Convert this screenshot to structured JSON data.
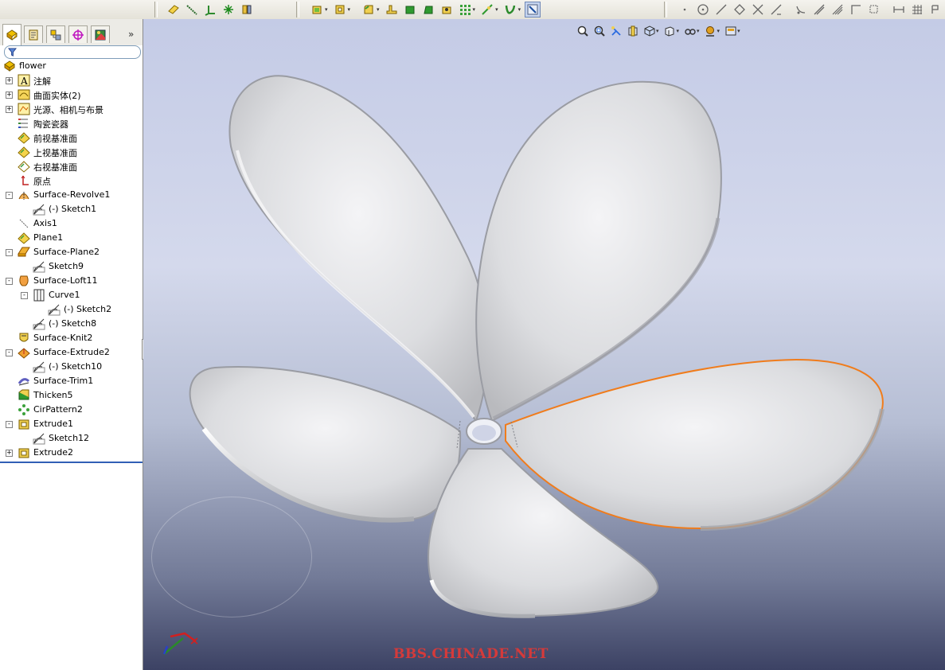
{
  "document_name": "flower",
  "feature_tree": [
    {
      "label": "flower",
      "expander": "",
      "icon": "part-icon",
      "indent": 0
    },
    {
      "label": "注解",
      "expander": "+",
      "icon": "annotation-icon",
      "indent": 1
    },
    {
      "label": "曲面实体(2)",
      "expander": "+",
      "icon": "surface-bodies-icon",
      "indent": 1
    },
    {
      "label": "光源、相机与布景",
      "expander": "+",
      "icon": "lights-cameras-icon",
      "indent": 1
    },
    {
      "label": "陶瓷瓷器",
      "expander": "",
      "icon": "material-icon",
      "indent": 1
    },
    {
      "label": "前视基准面",
      "expander": "",
      "icon": "plane-icon",
      "indent": 1
    },
    {
      "label": "上视基准面",
      "expander": "",
      "icon": "plane-icon",
      "indent": 1
    },
    {
      "label": "右视基准面",
      "expander": "",
      "icon": "plane-outline-icon",
      "indent": 1
    },
    {
      "label": "原点",
      "expander": "",
      "icon": "origin-icon",
      "indent": 1
    },
    {
      "label": "Surface-Revolve1",
      "expander": "-",
      "icon": "surface-revolve-icon",
      "indent": 1
    },
    {
      "label": "(-) Sketch1",
      "expander": "",
      "icon": "sketch-icon",
      "indent": 2
    },
    {
      "label": "Axis1",
      "expander": "",
      "icon": "axis-icon",
      "indent": 1
    },
    {
      "label": "Plane1",
      "expander": "",
      "icon": "plane-icon",
      "indent": 1
    },
    {
      "label": "Surface-Plane2",
      "expander": "-",
      "icon": "surface-plane-icon",
      "indent": 1
    },
    {
      "label": "Sketch9",
      "expander": "",
      "icon": "sketch-icon",
      "indent": 2
    },
    {
      "label": "Surface-Loft11",
      "expander": "-",
      "icon": "surface-loft-icon",
      "indent": 1
    },
    {
      "label": "Curve1",
      "expander": "-",
      "icon": "curve-icon",
      "indent": 2
    },
    {
      "label": "(-) Sketch2",
      "expander": "",
      "icon": "sketch-icon",
      "indent": 3
    },
    {
      "label": "(-) Sketch8",
      "expander": "",
      "icon": "sketch-icon",
      "indent": 2
    },
    {
      "label": "Surface-Knit2",
      "expander": "",
      "icon": "surface-knit-icon",
      "indent": 1
    },
    {
      "label": "Surface-Extrude2",
      "expander": "-",
      "icon": "surface-extrude-icon",
      "indent": 1
    },
    {
      "label": "(-) Sketch10",
      "expander": "",
      "icon": "sketch-icon",
      "indent": 2
    },
    {
      "label": "Surface-Trim1",
      "expander": "",
      "icon": "surface-trim-icon",
      "indent": 1
    },
    {
      "label": "Thicken5",
      "expander": "",
      "icon": "thicken-icon",
      "indent": 1
    },
    {
      "label": "CirPattern2",
      "expander": "",
      "icon": "circular-pattern-icon",
      "indent": 1
    },
    {
      "label": "Extrude1",
      "expander": "-",
      "icon": "extrude-icon",
      "indent": 1
    },
    {
      "label": "Sketch12",
      "expander": "",
      "icon": "sketch-icon",
      "indent": 2
    },
    {
      "label": "Extrude2",
      "expander": "+",
      "icon": "extrude-icon",
      "indent": 1
    }
  ],
  "panel_tabs": [
    "feature-manager-tab-icon",
    "property-manager-tab-icon",
    "configuration-manager-tab-icon",
    "dimxpert-tab-icon",
    "display-manager-tab-icon"
  ],
  "collapse_glyph": "»",
  "watermark": "BBS.CHINADE.NET",
  "colors": {
    "selection_edge": "#f07c1c",
    "watermark": "#d53a3a",
    "tree_end_bar": "#315fb5"
  }
}
